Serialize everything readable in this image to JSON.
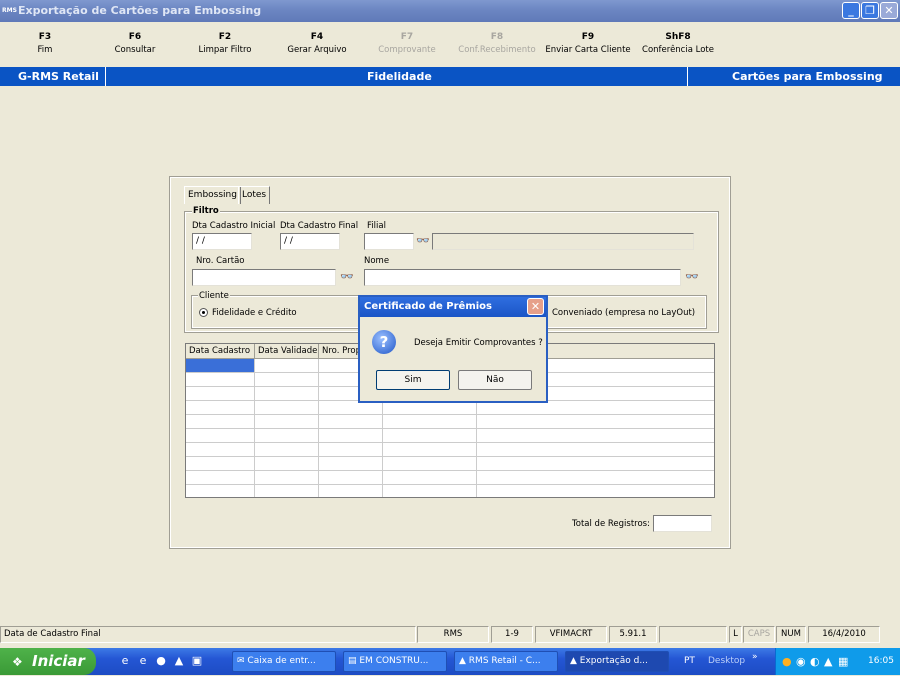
{
  "window": {
    "app_icon": "RMS",
    "title": "Exportação de Cartões para Embossing",
    "controls": [
      "minimize-icon",
      "restore-icon",
      "close-icon"
    ]
  },
  "fkeys": [
    {
      "key": "F3",
      "label": "Fim",
      "enabled": true
    },
    {
      "key": "F6",
      "label": "Consultar",
      "enabled": true
    },
    {
      "key": "F2",
      "label": "Limpar Filtro",
      "enabled": true
    },
    {
      "key": "F4",
      "label": "Gerar Arquivo",
      "enabled": true
    },
    {
      "key": "F7",
      "label": "Comprovante",
      "enabled": false
    },
    {
      "key": "F8",
      "label": "Conf.Recebimento",
      "enabled": false
    },
    {
      "key": "F9",
      "label": "Enviar Carta Cliente",
      "enabled": true
    },
    {
      "key": "ShF8",
      "label": "Conferência Lote",
      "enabled": true
    }
  ],
  "header": {
    "left": "G-RMS Retail",
    "center": "Fidelidade",
    "right": "Cartões para Embossing"
  },
  "tabs": [
    "Embossing",
    "Lotes"
  ],
  "filtro": {
    "legend": "Filtro",
    "dta_inicial_label": "Dta Cadastro Inicial",
    "dta_inicial_value": " / /",
    "dta_final_label": "Dta Cadastro Final",
    "dta_final_value": " / /",
    "filial_label": "Filial",
    "filial_value": "",
    "nro_cartao_label": "Nro. Cartão",
    "nro_cartao_value": "",
    "nome_label": "Nome",
    "nome_value": "",
    "cliente_legend": "Cliente",
    "radio_fidelidade": "Fidelidade e Crédito",
    "radio_conveniado": "Conveniado (empresa no LayOut)"
  },
  "grid": {
    "columns": [
      "Data Cadastro",
      "Data Validade",
      "Nro. Proposta"
    ],
    "total_label": "Total de Registros:",
    "total_value": ""
  },
  "dialog": {
    "title": "Certificado de Prêmios",
    "message": "Deseja Emitir Comprovantes ?",
    "yes": "Sim",
    "no": "Não"
  },
  "statusbar": {
    "message": "Data de Cadastro Final",
    "sys": "RMS",
    "range": "1-9",
    "program": "VFIMACRT",
    "version": "5.91.1",
    "ind_l": "L",
    "ind_caps": "CAPS",
    "ind_num": "NUM",
    "date": "16/4/2010"
  },
  "taskbar": {
    "start": "Iniciar",
    "tasks": [
      "Caixa de entr...",
      "EM CONSTRU...",
      "RMS Retail - C...",
      "Exportação d..."
    ],
    "lang": "PT",
    "desktop": "Desktop",
    "time": "16:05"
  },
  "colors": {
    "header_blue": "#0a54c4",
    "title_bar": "#6c86c2",
    "background": "#ece9d8",
    "selection": "#3a6fd8"
  }
}
